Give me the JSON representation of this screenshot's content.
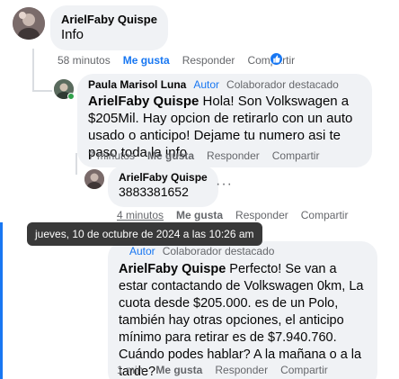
{
  "comments": [
    {
      "author": "ArielFaby Quispe",
      "text": "Info",
      "time": "58 minutos",
      "like": "Me gusta",
      "reply": "Responder",
      "share": "Compartir"
    },
    {
      "author": "Paula Marisol Luna",
      "badge_author": "Autor",
      "badge_top": "Colaborador destacado",
      "mention": "ArielFaby Quispe",
      "text": " Hola! Son Volkswagen a $205Mil. Hay opcion de retirarlo con un auto usado o anticipo! Dejame tu numero asi te paso toda la info",
      "time": "7 minutos",
      "like": "Me gusta",
      "reply": "Responder",
      "share": "Compartir"
    },
    {
      "author": "ArielFaby Quispe",
      "text": "3883381652",
      "time": "4 minutos",
      "like": "Me gusta",
      "reply": "Responder",
      "share": "Compartir",
      "more": "···"
    },
    {
      "badge_author": "Autor",
      "badge_top": "Colaborador destacado",
      "mention": "ArielFaby Quispe",
      "text": " Perfecto! Se van a estar contactando de Volkswagen 0km, La cuota desde $205.000. es de un Polo, también hay otras opciones, el anticipo mínimo para retirar es de $7.940.760. Cuándo podes hablar? A la mañana o a la tarde?",
      "time": "1 min",
      "like": "Me gusta",
      "reply": "Responder",
      "share": "Compartir"
    }
  ],
  "tooltip": "jueves, 10 de octubre de 2024 a las 10:26 am",
  "icons": {
    "avatar_1": "profile-photo-icon",
    "avatar_2": "profile-photo-icon",
    "reaction": "like-thumb-icon"
  },
  "colors": {
    "accent": "#1877f2",
    "bubble": "#f0f2f5",
    "muted": "#65676b",
    "online": "#31a24c"
  }
}
